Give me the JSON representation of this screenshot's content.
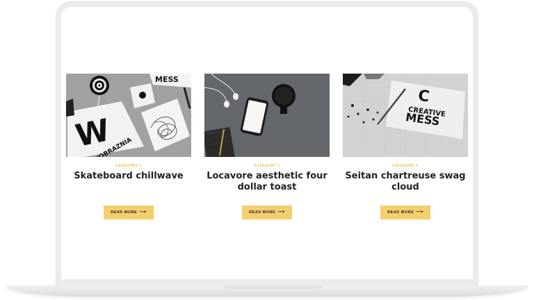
{
  "posts": [
    {
      "category": "CATEGORY 1",
      "title": "Skateboard chillwave",
      "button": "READ MORE",
      "arrow": "⟶",
      "image_text": [
        "W",
        "WYOBRAZNIA",
        "MESS"
      ]
    },
    {
      "category": "CATEGORY 1",
      "title": "Locavore aesthetic four dollar toast",
      "button": "READ MORE",
      "arrow": "⟶",
      "image_text": []
    },
    {
      "category": "CATEGORY 2",
      "title": "Seitan chartreuse swag cloud",
      "button": "READ MORE",
      "arrow": "⟶",
      "image_text": [
        "C",
        "CREATIVE",
        "MESS"
      ]
    }
  ],
  "colors": {
    "accent": "#f4cf6e",
    "category": "#f0b93a",
    "title": "#222222"
  }
}
